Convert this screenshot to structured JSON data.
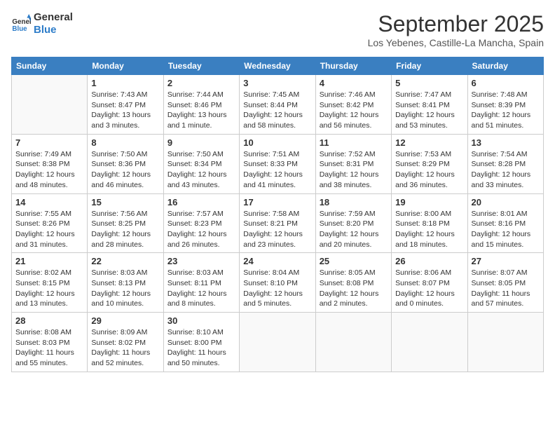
{
  "logo": {
    "line1": "General",
    "line2": "Blue"
  },
  "title": "September 2025",
  "location": "Los Yebenes, Castille-La Mancha, Spain",
  "headers": [
    "Sunday",
    "Monday",
    "Tuesday",
    "Wednesday",
    "Thursday",
    "Friday",
    "Saturday"
  ],
  "weeks": [
    [
      {
        "day": "",
        "info": ""
      },
      {
        "day": "1",
        "info": "Sunrise: 7:43 AM\nSunset: 8:47 PM\nDaylight: 13 hours\nand 3 minutes."
      },
      {
        "day": "2",
        "info": "Sunrise: 7:44 AM\nSunset: 8:46 PM\nDaylight: 13 hours\nand 1 minute."
      },
      {
        "day": "3",
        "info": "Sunrise: 7:45 AM\nSunset: 8:44 PM\nDaylight: 12 hours\nand 58 minutes."
      },
      {
        "day": "4",
        "info": "Sunrise: 7:46 AM\nSunset: 8:42 PM\nDaylight: 12 hours\nand 56 minutes."
      },
      {
        "day": "5",
        "info": "Sunrise: 7:47 AM\nSunset: 8:41 PM\nDaylight: 12 hours\nand 53 minutes."
      },
      {
        "day": "6",
        "info": "Sunrise: 7:48 AM\nSunset: 8:39 PM\nDaylight: 12 hours\nand 51 minutes."
      }
    ],
    [
      {
        "day": "7",
        "info": "Sunrise: 7:49 AM\nSunset: 8:38 PM\nDaylight: 12 hours\nand 48 minutes."
      },
      {
        "day": "8",
        "info": "Sunrise: 7:50 AM\nSunset: 8:36 PM\nDaylight: 12 hours\nand 46 minutes."
      },
      {
        "day": "9",
        "info": "Sunrise: 7:50 AM\nSunset: 8:34 PM\nDaylight: 12 hours\nand 43 minutes."
      },
      {
        "day": "10",
        "info": "Sunrise: 7:51 AM\nSunset: 8:33 PM\nDaylight: 12 hours\nand 41 minutes."
      },
      {
        "day": "11",
        "info": "Sunrise: 7:52 AM\nSunset: 8:31 PM\nDaylight: 12 hours\nand 38 minutes."
      },
      {
        "day": "12",
        "info": "Sunrise: 7:53 AM\nSunset: 8:29 PM\nDaylight: 12 hours\nand 36 minutes."
      },
      {
        "day": "13",
        "info": "Sunrise: 7:54 AM\nSunset: 8:28 PM\nDaylight: 12 hours\nand 33 minutes."
      }
    ],
    [
      {
        "day": "14",
        "info": "Sunrise: 7:55 AM\nSunset: 8:26 PM\nDaylight: 12 hours\nand 31 minutes."
      },
      {
        "day": "15",
        "info": "Sunrise: 7:56 AM\nSunset: 8:25 PM\nDaylight: 12 hours\nand 28 minutes."
      },
      {
        "day": "16",
        "info": "Sunrise: 7:57 AM\nSunset: 8:23 PM\nDaylight: 12 hours\nand 26 minutes."
      },
      {
        "day": "17",
        "info": "Sunrise: 7:58 AM\nSunset: 8:21 PM\nDaylight: 12 hours\nand 23 minutes."
      },
      {
        "day": "18",
        "info": "Sunrise: 7:59 AM\nSunset: 8:20 PM\nDaylight: 12 hours\nand 20 minutes."
      },
      {
        "day": "19",
        "info": "Sunrise: 8:00 AM\nSunset: 8:18 PM\nDaylight: 12 hours\nand 18 minutes."
      },
      {
        "day": "20",
        "info": "Sunrise: 8:01 AM\nSunset: 8:16 PM\nDaylight: 12 hours\nand 15 minutes."
      }
    ],
    [
      {
        "day": "21",
        "info": "Sunrise: 8:02 AM\nSunset: 8:15 PM\nDaylight: 12 hours\nand 13 minutes."
      },
      {
        "day": "22",
        "info": "Sunrise: 8:03 AM\nSunset: 8:13 PM\nDaylight: 12 hours\nand 10 minutes."
      },
      {
        "day": "23",
        "info": "Sunrise: 8:03 AM\nSunset: 8:11 PM\nDaylight: 12 hours\nand 8 minutes."
      },
      {
        "day": "24",
        "info": "Sunrise: 8:04 AM\nSunset: 8:10 PM\nDaylight: 12 hours\nand 5 minutes."
      },
      {
        "day": "25",
        "info": "Sunrise: 8:05 AM\nSunset: 8:08 PM\nDaylight: 12 hours\nand 2 minutes."
      },
      {
        "day": "26",
        "info": "Sunrise: 8:06 AM\nSunset: 8:07 PM\nDaylight: 12 hours\nand 0 minutes."
      },
      {
        "day": "27",
        "info": "Sunrise: 8:07 AM\nSunset: 8:05 PM\nDaylight: 11 hours\nand 57 minutes."
      }
    ],
    [
      {
        "day": "28",
        "info": "Sunrise: 8:08 AM\nSunset: 8:03 PM\nDaylight: 11 hours\nand 55 minutes."
      },
      {
        "day": "29",
        "info": "Sunrise: 8:09 AM\nSunset: 8:02 PM\nDaylight: 11 hours\nand 52 minutes."
      },
      {
        "day": "30",
        "info": "Sunrise: 8:10 AM\nSunset: 8:00 PM\nDaylight: 11 hours\nand 50 minutes."
      },
      {
        "day": "",
        "info": ""
      },
      {
        "day": "",
        "info": ""
      },
      {
        "day": "",
        "info": ""
      },
      {
        "day": "",
        "info": ""
      }
    ]
  ]
}
